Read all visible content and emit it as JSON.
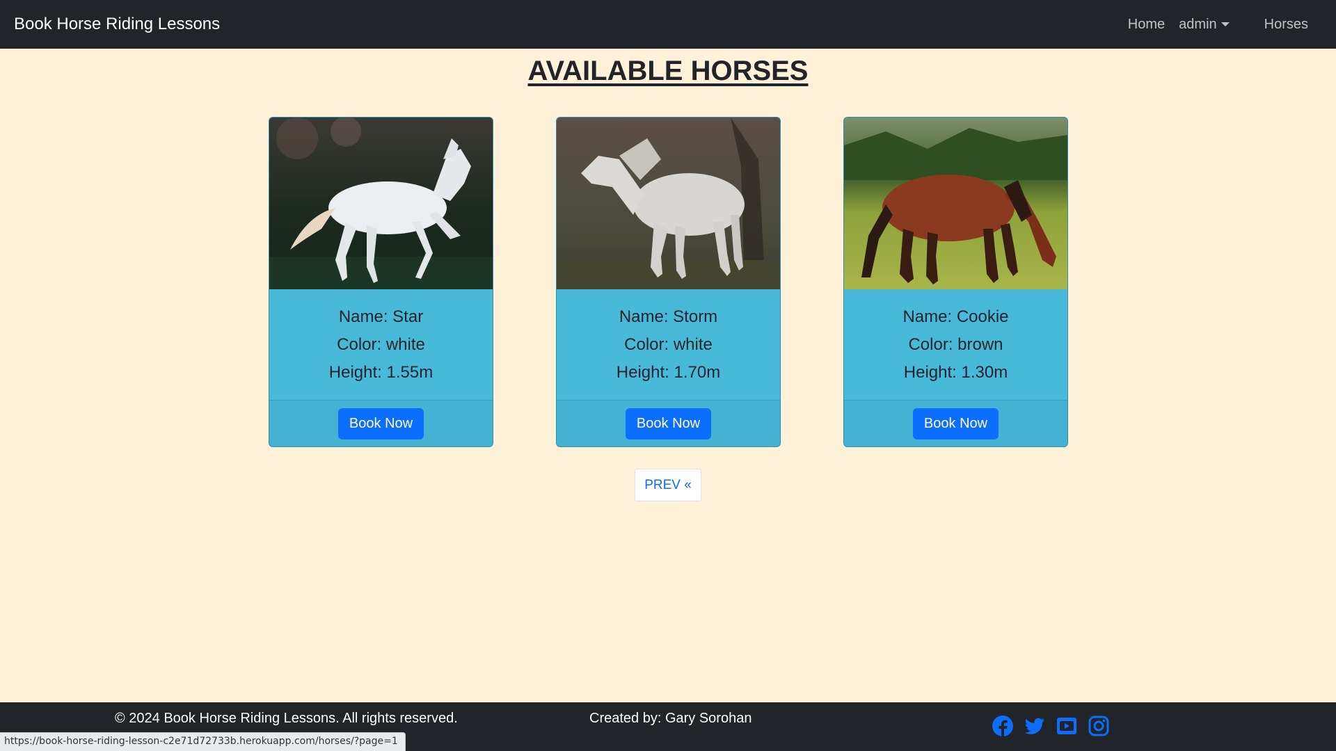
{
  "navbar": {
    "brand": "Book Horse Riding Lessons",
    "home": "Home",
    "admin": "admin",
    "horses": "Horses"
  },
  "page_title": "AVAILABLE HORSES",
  "horses": [
    {
      "name": "Name: Star",
      "color": "Color: white",
      "height": "Height: 1.55m",
      "button": "Book Now"
    },
    {
      "name": "Name: Storm",
      "color": "Color: white",
      "height": "Height: 1.70m",
      "button": "Book Now"
    },
    {
      "name": "Name: Cookie",
      "color": "Color: brown",
      "height": "Height: 1.30m",
      "button": "Book Now"
    }
  ],
  "pagination": {
    "prev": "PREV «"
  },
  "footer": {
    "copyright": "© 2024 Book Horse Riding Lessons. All rights reserved.",
    "credit": "Created by: Gary Sorohan",
    "social": [
      "facebook-icon",
      "twitter-icon",
      "youtube-icon",
      "instagram-icon"
    ]
  },
  "status_url": "https://book-horse-riding-lesson-c2e71d72733b.herokuapp.com/horses/?page=1",
  "colors": {
    "page_bg": "#fff2d8",
    "navbar_bg": "#212529",
    "card_bg": "#49b9da",
    "button_bg": "#0d6efd",
    "social_icon": "#0d6efd"
  }
}
